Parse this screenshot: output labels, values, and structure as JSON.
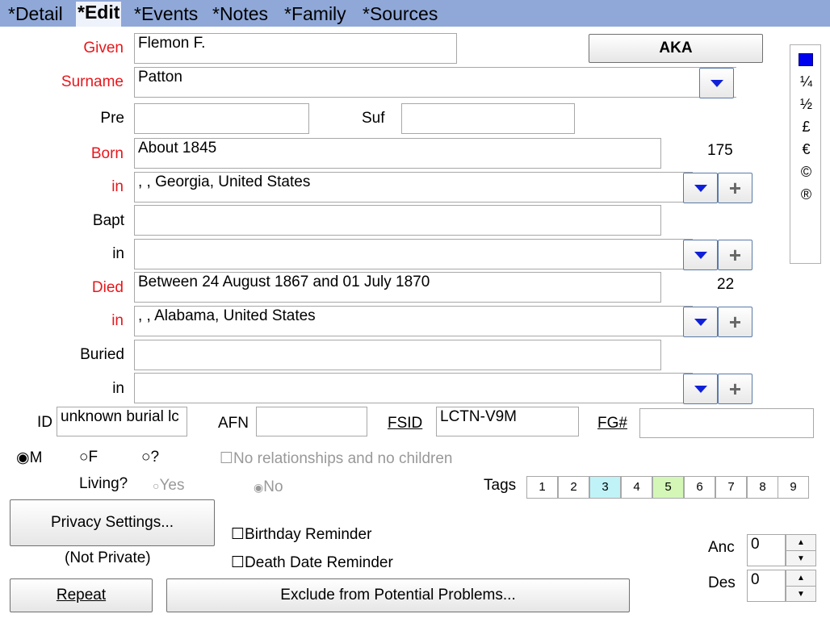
{
  "tabs": [
    {
      "label": "*Detail"
    },
    {
      "label": "*Edit",
      "active": true
    },
    {
      "label": "*Events"
    },
    {
      "label": "*Notes"
    },
    {
      "label": "*Family"
    },
    {
      "label": "*Sources"
    }
  ],
  "fields": {
    "given": {
      "label": "Given",
      "value": "Flemon F."
    },
    "surname": {
      "label": "Surname",
      "value": "Patton"
    },
    "pre": {
      "label": "Pre",
      "value": ""
    },
    "suf": {
      "label": "Suf",
      "value": ""
    },
    "born": {
      "label": "Born",
      "value": "About 1845",
      "age": "175"
    },
    "born_in": {
      "label": "in",
      "value": ", , Georgia, United States"
    },
    "bapt": {
      "label": "Bapt",
      "value": ""
    },
    "bapt_in": {
      "label": "in",
      "value": ""
    },
    "died": {
      "label": "Died",
      "value": "Between 24 August 1867 and 01 July 1870",
      "age": "22"
    },
    "died_in": {
      "label": "in",
      "value": ", , Alabama, United States"
    },
    "buried": {
      "label": "Buried",
      "value": ""
    },
    "buried_in": {
      "label": "in",
      "value": ""
    },
    "id": {
      "label": "ID",
      "value": "unknown burial lc"
    },
    "afn": {
      "label": "AFN",
      "value": ""
    },
    "fsid": {
      "label": "FSID",
      "value": "LCTN-V9M"
    },
    "fg": {
      "label": "FG#",
      "value": ""
    }
  },
  "aka_button": "AKA",
  "symbols": [
    "¼",
    "½",
    "£",
    "€",
    "©",
    "®"
  ],
  "symbol_color": "#0000ee",
  "sex": {
    "m": "M",
    "f": "F",
    "unknown": "?",
    "selected": "M"
  },
  "no_relationships": "No relationships and no children",
  "living": {
    "label": "Living?",
    "yes": "Yes",
    "no": "No",
    "selected": "No"
  },
  "tags": {
    "label": "Tags",
    "items": [
      "1",
      "2",
      "3",
      "4",
      "5",
      "6",
      "7",
      "8",
      "9"
    ],
    "highlight": {
      "3": "#bff3f7",
      "5": "#d4f7b8"
    }
  },
  "privacy": {
    "button": "Privacy Settings...",
    "status": "(Not Private)"
  },
  "reminders": {
    "birthday": "Birthday Reminder",
    "death": "Death Date Reminder"
  },
  "buttons": {
    "repeat": "Repeat",
    "exclude": "Exclude from Potential Problems..."
  },
  "anc": {
    "label": "Anc",
    "value": "0"
  },
  "des": {
    "label": "Des",
    "value": "0"
  },
  "colors": {
    "tabbar": "#8fa8d8",
    "required_label": "#e8161b",
    "dropdown_arrow": "#1020d8"
  }
}
